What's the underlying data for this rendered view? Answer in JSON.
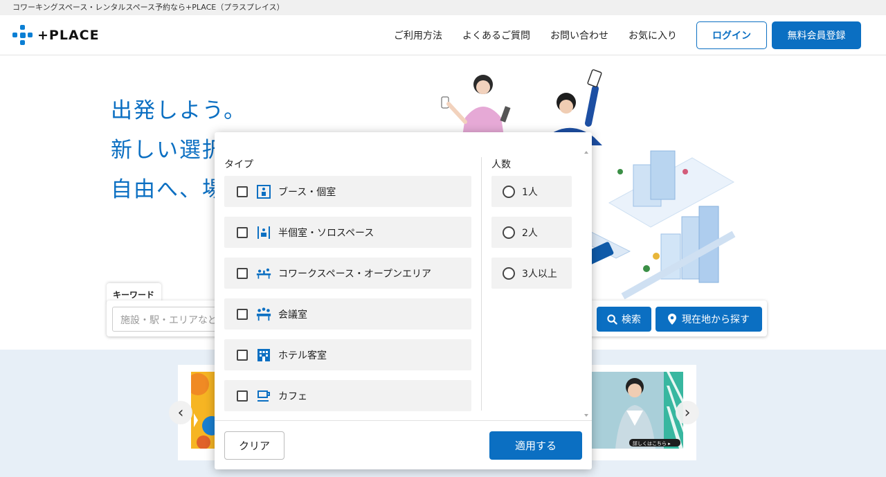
{
  "topbar": {
    "text": "コワーキングスペース・レンタルスペース予約なら+PLACE（プラスプレイス）"
  },
  "header": {
    "logo_text": "+PLACE",
    "nav": [
      "ご利用方法",
      "よくあるご質問",
      "お問い合わせ",
      "お気に入り"
    ],
    "login_label": "ログイン",
    "register_label": "無料会員登録",
    "brand_color": "#0b6fc2"
  },
  "hero": {
    "headline_1": "出発しよう。",
    "headline_2": "新しい選択",
    "headline_3": "自由へ、場"
  },
  "search": {
    "keyword_tab": "キーワード",
    "placeholder": "施設・駅・エリアなど",
    "search_label": "検索",
    "location_label": "現在地から探す"
  },
  "modal": {
    "type_heading": "タイプ",
    "capacity_heading": "人数",
    "types": [
      {
        "label": "ブース・個室",
        "icon": "booth-icon"
      },
      {
        "label": "半個室・ソロスペース",
        "icon": "semi-private-icon"
      },
      {
        "label": "コワークスペース・オープンエリア",
        "icon": "cowork-icon"
      },
      {
        "label": "会議室",
        "icon": "meeting-room-icon"
      },
      {
        "label": "ホテル客室",
        "icon": "hotel-icon"
      },
      {
        "label": "カフェ",
        "icon": "cafe-icon"
      }
    ],
    "capacities": [
      "1人",
      "2人",
      "3人以上"
    ],
    "clear_label": "クリア",
    "apply_label": "適用する"
  },
  "banner": {
    "detail_badge": "詳しくはこちら ▸"
  }
}
